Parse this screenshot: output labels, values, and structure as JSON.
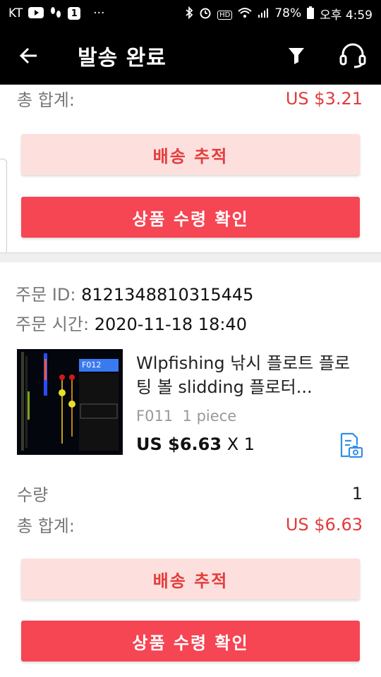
{
  "status_bar": {
    "carrier": "KT",
    "notif_badge": "1",
    "overflow": "···",
    "battery": "78%",
    "time": "오후 4:59",
    "hd_label": "HD"
  },
  "app_bar": {
    "title": "발송 완료",
    "icons": [
      "back-arrow-icon",
      "filter-icon",
      "headset-icon"
    ]
  },
  "order_prev": {
    "total_label": "총 합계:",
    "total_value": "US $3.21",
    "track_label": "배송 추적",
    "confirm_label": "상품 수령 확인"
  },
  "order": {
    "id_label": "주문 ID:",
    "id_value": "8121348810315445",
    "time_label": "주문 시간:",
    "time_value": "2020-11-18 18:40",
    "product": {
      "title": "Wlpfishing 낚시 플로트 플로팅 볼 slidding 플로터...",
      "sku": "F011",
      "sku_qty": "1 piece",
      "price": "US $6.63",
      "qty": "X 1",
      "thumb_code": "F012"
    },
    "quantity_label": "수량",
    "quantity_value": "1",
    "total_label": "총 합계:",
    "total_value": "US $6.63",
    "track_label": "배송 추적",
    "confirm_label": "상품 수령 확인"
  },
  "colors": {
    "accent": "#f64553",
    "accent_light": "#fde0de",
    "price": "#e23a3a"
  }
}
